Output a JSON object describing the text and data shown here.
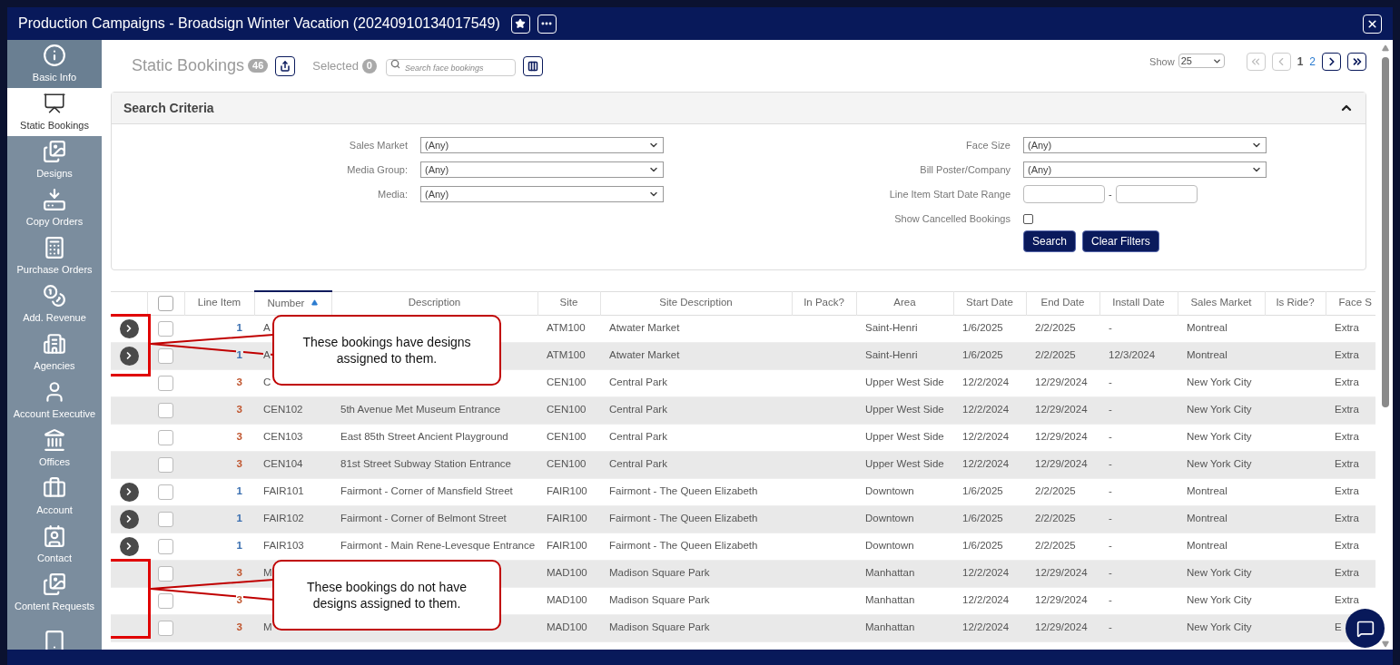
{
  "window": {
    "title": "Production Campaigns - Broadsign Winter Vacation (20240910134017549)"
  },
  "sidebar": {
    "items": [
      {
        "label": "Basic Info",
        "selected": false
      },
      {
        "label": "Static Bookings",
        "selected": true
      },
      {
        "label": "Designs",
        "selected": false
      },
      {
        "label": "Copy Orders",
        "selected": false
      },
      {
        "label": "Purchase Orders",
        "selected": false
      },
      {
        "label": "Add. Revenue",
        "selected": false
      },
      {
        "label": "Agencies",
        "selected": false
      },
      {
        "label": "Account Executive",
        "selected": false
      },
      {
        "label": "Offices",
        "selected": false
      },
      {
        "label": "Account",
        "selected": false
      },
      {
        "label": "Contact",
        "selected": false
      },
      {
        "label": "Content Requests",
        "selected": false
      },
      {
        "selected": false
      }
    ]
  },
  "toolbar": {
    "title": "Static Bookings",
    "count": "46",
    "selected_label": "Selected",
    "selected_count": "0",
    "search": {
      "placeholder": "Search face bookings"
    },
    "show_label": "Show",
    "page_size": "25",
    "pages": [
      {
        "label": "1",
        "selected": true
      },
      {
        "label": "2",
        "selected": false
      }
    ]
  },
  "search_criteria": {
    "title": "Search Criteria",
    "expanded": true,
    "left_fields": [
      {
        "kind": "select",
        "label": "Sales Market",
        "value": "(Any)"
      },
      {
        "kind": "select",
        "label": "Media Group:",
        "value": "(Any)"
      },
      {
        "kind": "select",
        "label": "Media:",
        "value": "(Any)"
      }
    ],
    "right_fields": [
      {
        "kind": "select",
        "label": "Face Size",
        "value": "(Any)"
      },
      {
        "kind": "select",
        "label": "Bill Poster/Company",
        "value": "(Any)"
      },
      {
        "kind": "date_range",
        "label": "Line Item Start Date Range",
        "separator": "-"
      },
      {
        "kind": "checkbox",
        "label": "Show Cancelled Bookings",
        "checked": false
      }
    ],
    "buttons": [
      "Search",
      "Clear Filters"
    ]
  },
  "table": {
    "select_all_checked": false,
    "columns": [
      "Line Item",
      "Number",
      "Description",
      "Site",
      "Site Description",
      "In Pack?",
      "Area",
      "Start Date",
      "End Date",
      "Install Date",
      "Sales Market",
      "Is Ride?",
      "Face S"
    ],
    "rows": [
      {
        "has_designs": true,
        "checked": false,
        "line_item": "1",
        "color": "#3a6fb0",
        "number": "A",
        "site": "ATM100",
        "site_description": "Atwater Market",
        "area": "Saint-Henri",
        "start": "1/6/2025",
        "end": "2/2/2025",
        "install": "-",
        "market": "Montreal",
        "face": "Extra"
      },
      {
        "has_designs": true,
        "checked": false,
        "line_item": "1",
        "color": "#3a6fb0",
        "number": "A",
        "site": "ATM100",
        "site_description": "Atwater Market",
        "area": "Saint-Henri",
        "start": "1/6/2025",
        "end": "2/2/2025",
        "install": "12/3/2024",
        "market": "Montreal",
        "face": "Extra"
      },
      {
        "has_designs": false,
        "checked": false,
        "line_item": "3",
        "color": "#c0562f",
        "number": "C",
        "site": "CEN100",
        "site_description": "Central Park",
        "area": "Upper West Side",
        "start": "12/2/2024",
        "end": "12/29/2024",
        "install": "-",
        "market": "New York City",
        "face": "Extra"
      },
      {
        "has_designs": false,
        "checked": false,
        "line_item": "3",
        "color": "#c0562f",
        "number": "CEN102",
        "description": "5th Avenue Met Museum Entrance",
        "site": "CEN100",
        "site_description": "Central Park",
        "area": "Upper West Side",
        "start": "12/2/2024",
        "end": "12/29/2024",
        "install": "-",
        "market": "New York City",
        "face": "Extra"
      },
      {
        "has_designs": false,
        "checked": false,
        "line_item": "3",
        "color": "#c0562f",
        "number": "CEN103",
        "description": "East 85th Street Ancient Playground",
        "site": "CEN100",
        "site_description": "Central Park",
        "area": "Upper West Side",
        "start": "12/2/2024",
        "end": "12/29/2024",
        "install": "-",
        "market": "New York City",
        "face": "Extra"
      },
      {
        "has_designs": false,
        "checked": false,
        "line_item": "3",
        "color": "#c0562f",
        "number": "CEN104",
        "description": "81st Street Subway Station Entrance",
        "site": "CEN100",
        "site_description": "Central Park",
        "area": "Upper West Side",
        "start": "12/2/2024",
        "end": "12/29/2024",
        "install": "-",
        "market": "New York City",
        "face": "Extra"
      },
      {
        "has_designs": true,
        "checked": false,
        "line_item": "1",
        "color": "#3a6fb0",
        "number": "FAIR101",
        "description": "Fairmont - Corner of Mansfield Street",
        "site": "FAIR100",
        "site_description": "Fairmont - The Queen Elizabeth",
        "area": "Downtown",
        "start": "1/6/2025",
        "end": "2/2/2025",
        "install": "-",
        "market": "Montreal",
        "face": "Extra"
      },
      {
        "has_designs": true,
        "checked": false,
        "line_item": "1",
        "color": "#3a6fb0",
        "number": "FAIR102",
        "description": "Fairmont - Corner of Belmont Street",
        "site": "FAIR100",
        "site_description": "Fairmont - The Queen Elizabeth",
        "area": "Downtown",
        "start": "1/6/2025",
        "end": "2/2/2025",
        "install": "-",
        "market": "Montreal",
        "face": "Extra"
      },
      {
        "has_designs": true,
        "checked": false,
        "line_item": "1",
        "color": "#3a6fb0",
        "number": "FAIR103",
        "description": "Fairmont - Main Rene-Levesque Entrance",
        "site": "FAIR100",
        "site_description": "Fairmont - The Queen Elizabeth",
        "area": "Downtown",
        "start": "1/6/2025",
        "end": "2/2/2025",
        "install": "-",
        "market": "Montreal",
        "face": "Extra"
      },
      {
        "has_designs": false,
        "checked": false,
        "line_item": "3",
        "color": "#c0562f",
        "number": "M",
        "site": "MAD100",
        "site_description": "Madison Square Park",
        "area": "Manhattan",
        "start": "12/2/2024",
        "end": "12/29/2024",
        "install": "-",
        "market": "New York City",
        "face": "Extra"
      },
      {
        "has_designs": false,
        "checked": false,
        "line_item": "3",
        "color": "#c0562f",
        "site": "MAD100",
        "site_description": "Madison Square Park",
        "area": "Manhattan",
        "start": "12/2/2024",
        "end": "12/29/2024",
        "install": "-",
        "market": "New York City",
        "face": "Extra"
      },
      {
        "has_designs": false,
        "checked": false,
        "line_item": "3",
        "color": "#c0562f",
        "number": "M",
        "site": "MAD100",
        "site_description": "Madison Square Park",
        "area": "Manhattan",
        "start": "12/2/2024",
        "end": "12/29/2024",
        "install": "-",
        "market": "New York City",
        "face": "E"
      }
    ]
  },
  "callouts": [
    {
      "text": "These bookings have designs assigned to them."
    },
    {
      "text": "These bookings do not have designs assigned to them."
    }
  ]
}
